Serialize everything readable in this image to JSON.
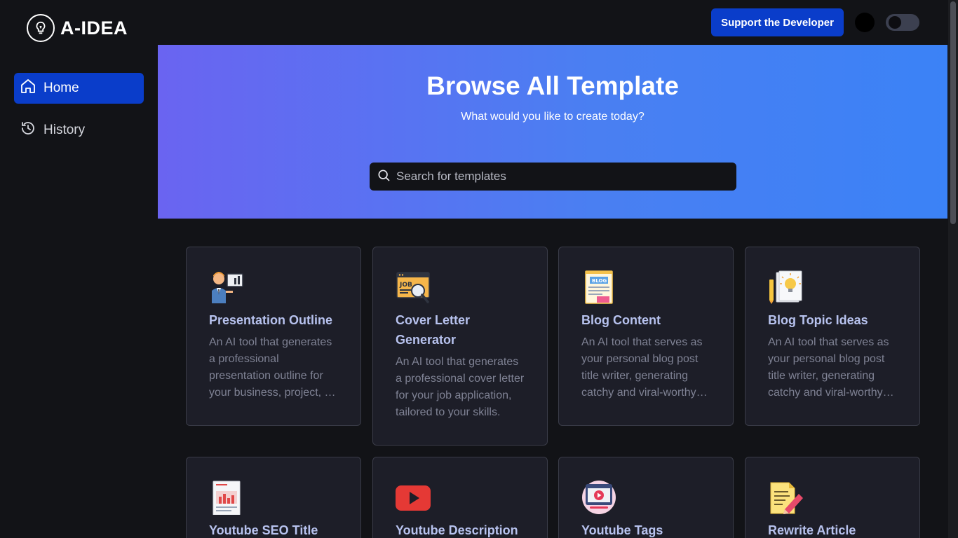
{
  "app": {
    "name": "A-IDEA"
  },
  "header": {
    "support_label": "Support the Developer"
  },
  "sidebar": {
    "items": [
      {
        "label": "Home",
        "icon": "home-icon",
        "active": true
      },
      {
        "label": "History",
        "icon": "history-icon",
        "active": false
      }
    ]
  },
  "hero": {
    "title": "Browse All Template",
    "subtitle": "What would you like to create today?",
    "search_placeholder": "Search for templates"
  },
  "templates": [
    {
      "title": "Presentation Outline",
      "icon": "presenter-icon",
      "desc": "An AI tool that generates a professional presentation outline for your business, project, or event."
    },
    {
      "title": "Cover Letter Generator",
      "icon": "job-search-icon",
      "desc": "An AI tool that generates a professional cover letter for your job application, tailored to your skills."
    },
    {
      "title": "Blog Content",
      "icon": "blog-page-icon",
      "desc": "An AI tool that serves as your personal blog post title writer, generating catchy and viral-worthy content."
    },
    {
      "title": "Blog Topic Ideas",
      "icon": "lightbulb-document-icon",
      "desc": "An AI tool that serves as your personal blog post title writer, generating catchy and viral-worthy ideas."
    },
    {
      "title": "Youtube SEO Title",
      "icon": "seo-report-icon",
      "desc": ""
    },
    {
      "title": "Youtube Description",
      "icon": "youtube-icon",
      "desc": ""
    },
    {
      "title": "Youtube Tags",
      "icon": "video-tags-icon",
      "desc": ""
    },
    {
      "title": "Rewrite Article",
      "icon": "rewrite-pencil-icon",
      "desc": ""
    }
  ],
  "colors": {
    "accent": "#0a3dca",
    "hero_start": "#6a64f1",
    "hero_end": "#3b82f6",
    "card_bg": "#1d1e28",
    "title": "#b7c2ee"
  }
}
